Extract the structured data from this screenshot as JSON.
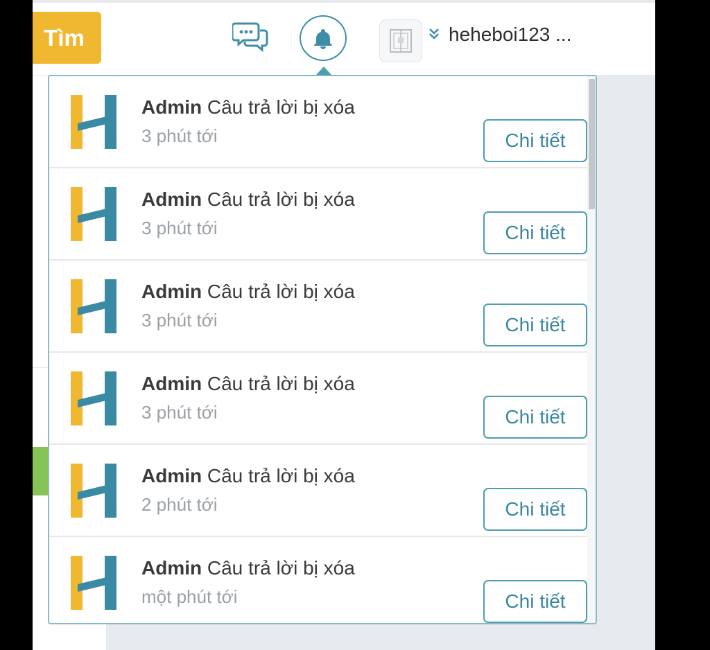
{
  "header": {
    "search_label": "Tìm",
    "username": "heheboi123 ..."
  },
  "icons": {
    "chat": "chat-bubbles-icon",
    "bell": "bell-icon",
    "avatar": "avatar-icon",
    "chevron": "double-chevron-down-icon"
  },
  "colors": {
    "accent": "#3d8fa7",
    "logo_yellow": "#f0b830",
    "logo_teal": "#3b8aa3",
    "search_button": "#f0b830"
  },
  "notifications": [
    {
      "sender": "Admin",
      "message": "Câu trả lời bị xóa",
      "time": "3 phút tới",
      "button": "Chi tiết"
    },
    {
      "sender": "Admin",
      "message": "Câu trả lời bị xóa",
      "time": "3 phút tới",
      "button": "Chi tiết"
    },
    {
      "sender": "Admin",
      "message": "Câu trả lời bị xóa",
      "time": "3 phút tới",
      "button": "Chi tiết"
    },
    {
      "sender": "Admin",
      "message": "Câu trả lời bị xóa",
      "time": "3 phút tới",
      "button": "Chi tiết"
    },
    {
      "sender": "Admin",
      "message": "Câu trả lời bị xóa",
      "time": "2 phút tới",
      "button": "Chi tiết"
    },
    {
      "sender": "Admin",
      "message": "Câu trả lời bị xóa",
      "time": "một phút tới",
      "button": "Chi tiết"
    }
  ]
}
